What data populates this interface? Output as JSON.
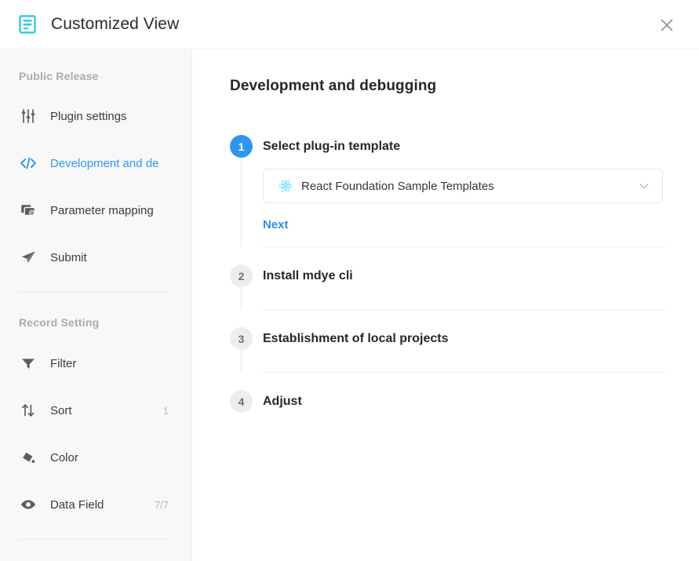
{
  "window": {
    "title": "Customized View",
    "app_icon": "document-lines-icon",
    "app_icon_color": "#3ccbe4",
    "close_icon": "close-icon"
  },
  "sidebar": {
    "sections": [
      {
        "title": "Public Release",
        "items": [
          {
            "label": "Plugin settings",
            "icon": "sliders-icon",
            "badge": "",
            "active": false
          },
          {
            "label": "Development and de",
            "icon": "code-brackets-icon",
            "badge": "",
            "active": true
          },
          {
            "label": "Parameter mapping",
            "icon": "layers-gear-icon",
            "badge": "",
            "active": false
          },
          {
            "label": "Submit",
            "icon": "paper-plane-icon",
            "badge": "",
            "active": false
          }
        ]
      },
      {
        "title": "Record Setting",
        "items": [
          {
            "label": "Filter",
            "icon": "funnel-icon",
            "badge": "",
            "active": false
          },
          {
            "label": "Sort",
            "icon": "sort-arrows-icon",
            "badge": "1",
            "active": false
          },
          {
            "label": "Color",
            "icon": "paint-fill-icon",
            "badge": "",
            "active": false
          },
          {
            "label": "Data Field",
            "icon": "eye-icon",
            "badge": "7/7",
            "active": false
          }
        ]
      }
    ]
  },
  "main": {
    "page_title": "Development and debugging",
    "accent_color": "#2f96f0",
    "steps": [
      {
        "number": "1",
        "title": "Select plug-in template",
        "active": true,
        "select": {
          "value": "React Foundation Sample Templates",
          "icon": "react-logo-icon",
          "caret": "chevron-down-icon"
        },
        "next_label": "Next"
      },
      {
        "number": "2",
        "title": "Install mdye cli",
        "active": false
      },
      {
        "number": "3",
        "title": "Establishment of local projects",
        "active": false
      },
      {
        "number": "4",
        "title": "Adjust",
        "active": false
      }
    ]
  }
}
